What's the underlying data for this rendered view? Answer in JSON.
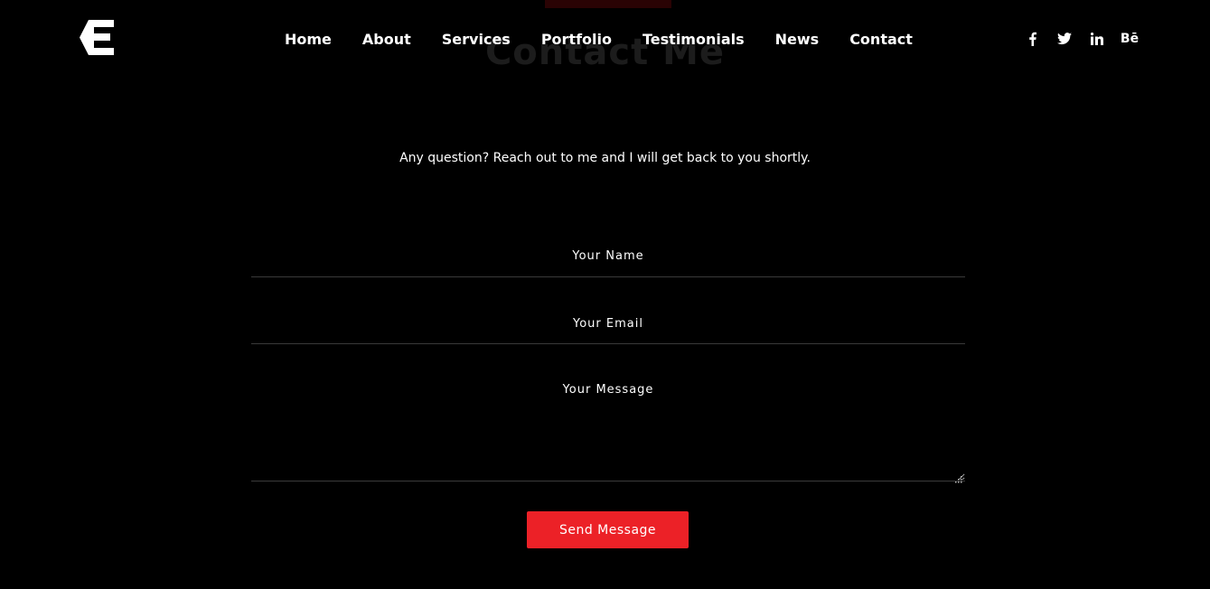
{
  "brand": {
    "logo_icon": "e-logo-icon"
  },
  "section": {
    "heading": "Contact Me",
    "intro": "Any question? Reach out to me and I will get back to you shortly."
  },
  "nav": {
    "items": [
      {
        "label": "Home"
      },
      {
        "label": "About"
      },
      {
        "label": "Services"
      },
      {
        "label": "Portfolio"
      },
      {
        "label": "Testimonials"
      },
      {
        "label": "News"
      },
      {
        "label": "Contact"
      }
    ]
  },
  "social": {
    "items": [
      {
        "icon": "facebook-icon"
      },
      {
        "icon": "twitter-icon"
      },
      {
        "icon": "linkedin-icon"
      },
      {
        "icon": "behance-icon",
        "text": "Bē"
      }
    ]
  },
  "form": {
    "name_placeholder": "Your Name",
    "email_placeholder": "Your Email",
    "message_placeholder": "Your Message",
    "name_value": "",
    "email_value": "",
    "message_value": "",
    "submit_label": "Send Message"
  },
  "colors": {
    "background": "#000000",
    "accent": "#ec2127",
    "text": "#ffffff",
    "divider": "#3a3a3a"
  }
}
